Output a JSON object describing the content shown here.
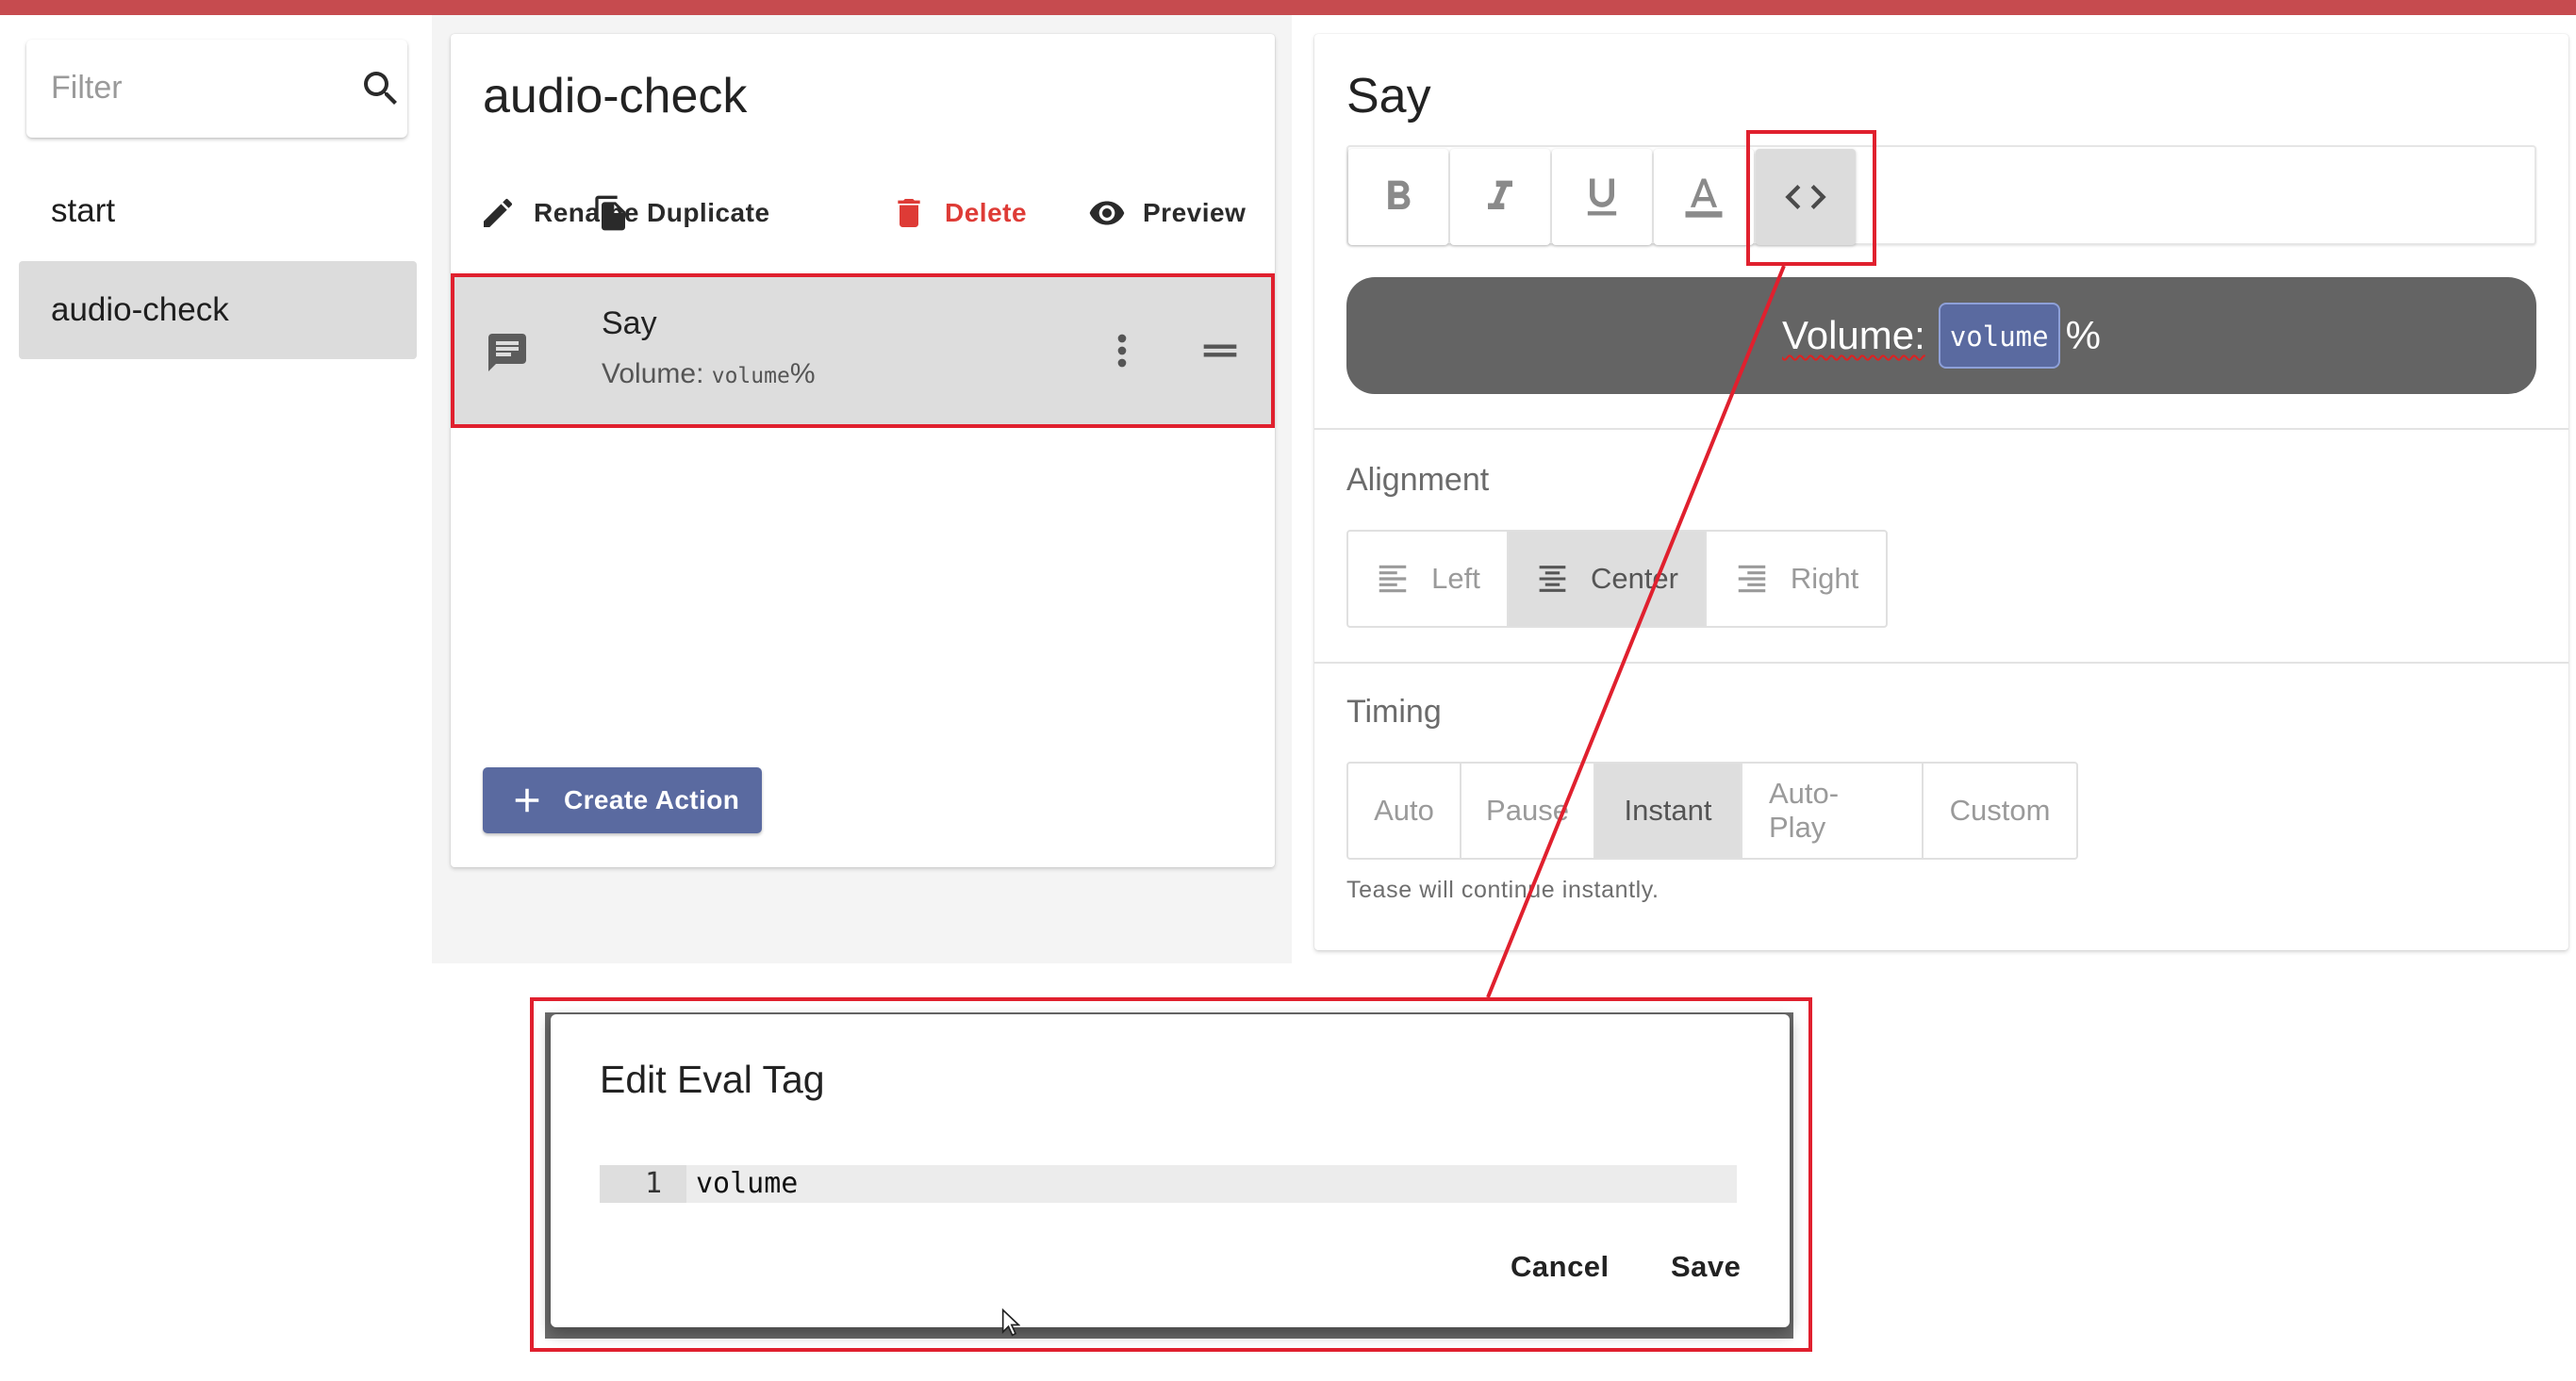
{
  "sidebar": {
    "filter_placeholder": "Filter",
    "pages": [
      {
        "label": "start",
        "active": false
      },
      {
        "label": "audio-check",
        "active": true
      }
    ]
  },
  "page": {
    "title": "audio-check",
    "toolbar": {
      "rename": "Rename",
      "duplicate": "Duplicate",
      "delete": "Delete",
      "preview": "Preview"
    },
    "actions": [
      {
        "title": "Say",
        "subtitle_text": "Volume: ",
        "subtitle_code": "volume",
        "subtitle_suffix": "%"
      }
    ],
    "create_action": "Create Action"
  },
  "editor": {
    "title": "Say",
    "format_buttons": [
      "bold",
      "italic",
      "underline",
      "text-color",
      "eval-code"
    ],
    "active_format": "eval-code",
    "preview": {
      "text": "Volume:",
      "eval_tag": "volume",
      "suffix": "%"
    },
    "alignment": {
      "label": "Alignment",
      "options": [
        "Left",
        "Center",
        "Right"
      ],
      "selected": "Center"
    },
    "timing": {
      "label": "Timing",
      "options": [
        "Auto",
        "Pause",
        "Instant",
        "Auto-Play",
        "Custom"
      ],
      "selected": "Instant",
      "hint": "Tease will continue instantly."
    }
  },
  "dialog": {
    "title": "Edit Eval Tag",
    "line_number": "1",
    "code": "volume",
    "cancel": "Cancel",
    "save": "Save"
  },
  "colors": {
    "top_bar": "#c64b4f",
    "accent": "#5a6aa0",
    "danger": "#de3b36",
    "highlight": "#e0202e"
  }
}
